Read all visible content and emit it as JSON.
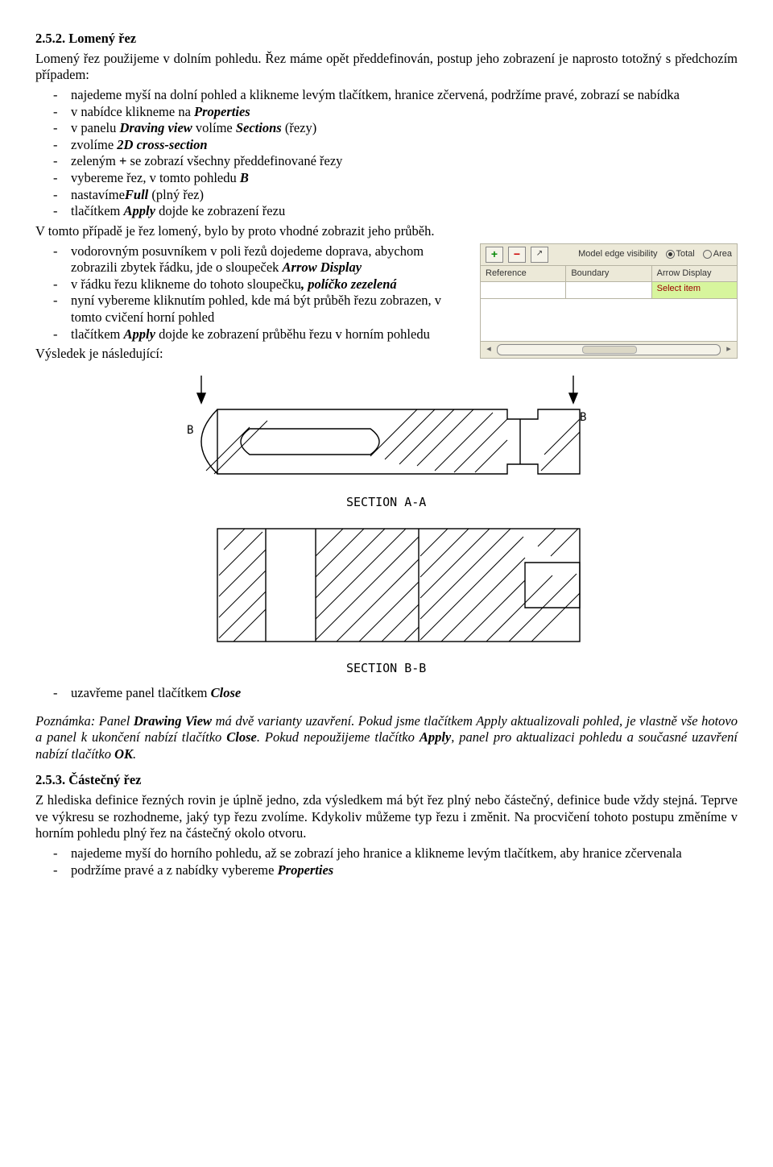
{
  "h1": {
    "num": "2.5.2.",
    "title": "Lomený řez"
  },
  "p1": "Lomený řez použijeme v dolním pohledu. Řez máme opět předdefinován, postup jeho zobrazení je naprosto totožný s předchozím případem:",
  "list1": {
    "i1a": "najedeme myší na dolní pohled a klikneme levým tlačítkem, hranice zčervená, podržíme pravé, zobrazí se nabídka",
    "i2a": "v nabídce klikneme na ",
    "i2b": "Properties",
    "i3a": "v panelu ",
    "i3b": "Draving view",
    "i3c": " volíme ",
    "i3d": "Sections",
    "i3e": " (řezy)",
    "i4a": "zvolíme ",
    "i4b": "2D cross-section",
    "i5a": "zeleným ",
    "i5b": "+",
    "i5c": " se zobrazí všechny předdefinované řezy",
    "i6a": "vybereme řez, v tomto pohledu ",
    "i6b": "B",
    "i7a": "nastavíme",
    "i7b": "Full ",
    "i7c": " (plný řez)",
    "i8a": "tlačítkem ",
    "i8b": "Apply",
    "i8c": " dojde ke zobrazení řezu"
  },
  "p2": "V tomto případě je řez lomený, bylo by proto vhodné zobrazit jeho průběh.",
  "panel": {
    "visLabel": "Model edge visibility",
    "radioTotal": "Total",
    "radioArea": "Area",
    "colRef": "Reference",
    "colBoundary": "Boundary",
    "colArrow": "Arrow Display",
    "selectItem": "Select item"
  },
  "list2": {
    "i1a": "vodorovným posuvníkem v poli řezů dojedeme doprava, abychom zobrazili zbytek řádku, jde o sloupeček ",
    "i1b": "Arrow Display",
    "i2a": "v řádku řezu klikneme do tohoto sloupečku",
    "i2b": ", políčko zezelená",
    "i3a": "nyní vybereme kliknutím pohled, kde má být průběh řezu zobrazen, v tomto cvičení horní pohled",
    "i4a": "tlačítkem ",
    "i4b": "Apply",
    "i4c": " dojde ke zobrazení průběhu řezu v horním pohledu"
  },
  "p3": "Výsledek je následující:",
  "drawing": {
    "labA": "SECTION  A-A",
    "labB": "SECTION  B-B",
    "arrowB1": "B",
    "arrowB2": "B"
  },
  "close": {
    "a": "uzavřeme panel tlačítkem ",
    "b": "Close"
  },
  "note": {
    "a": "Poznámka: Panel ",
    "b": "Drawing View",
    "c": " má dvě varianty uzavření. Pokud jsme tlačítkem Apply aktualizovali pohled, je vlastně vše hotovo a panel k ukončení nabízí tlačítko ",
    "d": "Close",
    "e": ". Pokud nepoužijeme tlačítko ",
    "f": "Apply",
    "g": ", panel pro aktualizaci pohledu a současné uzavření nabízí tlačítko ",
    "h": "OK",
    "i": "."
  },
  "h2": {
    "num": "2.5.3.",
    "title": "Částečný řez"
  },
  "p4": "Z hlediska definice řezných rovin je úplně jedno, zda výsledkem má být řez plný nebo částečný, definice bude vždy stejná. Teprve ve výkresu se rozhodneme, jaký typ řezu zvolíme. Kdykoliv můžeme typ řezu i změnit. Na procvičení tohoto postupu změníme v horním pohledu plný řez na částečný okolo otvoru.",
  "list3": {
    "i1": "najedeme myší do horního pohledu, až se zobrazí jeho hranice a klikneme levým tlačítkem, aby hranice zčervenala",
    "i2a": "podržíme pravé a z nabídky vybereme ",
    "i2b": "Properties"
  }
}
